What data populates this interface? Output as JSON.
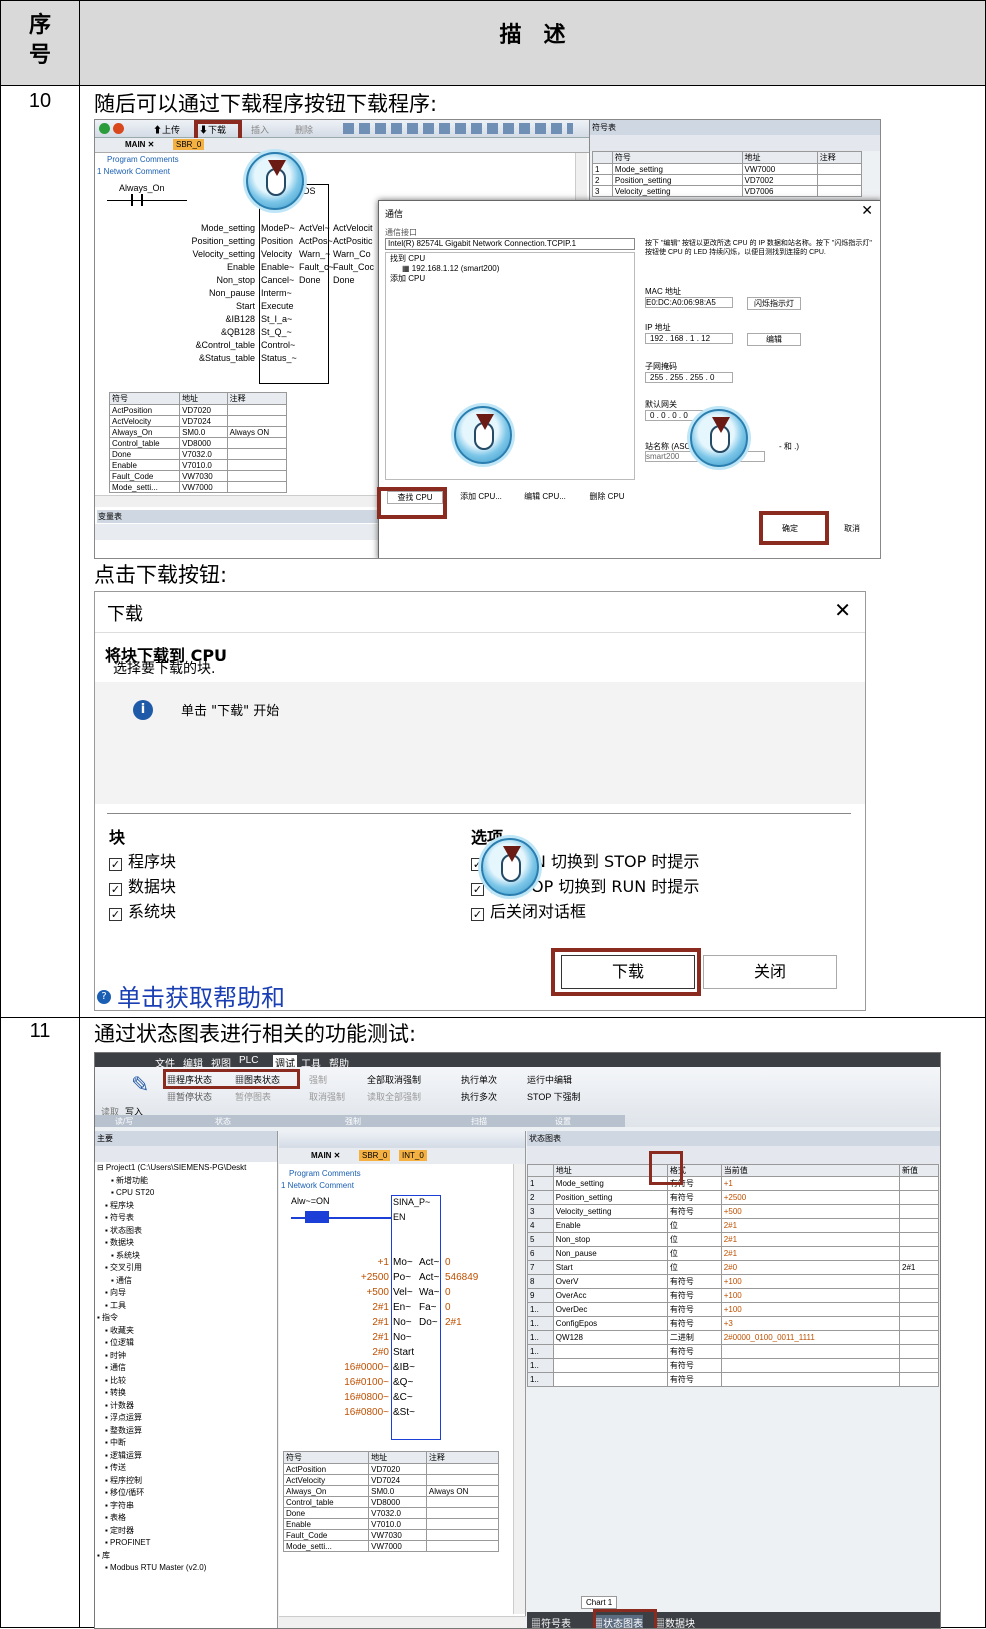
{
  "header": {
    "col1": "序\n号",
    "col2": "描　述"
  },
  "row10": {
    "num": "10",
    "intro": "随后可以通过下载程序按钮下载程序:",
    "toolbar": {
      "upload": "上传",
      "download": "下载",
      "insert": "插入",
      "delete": "删除"
    },
    "tabs": {
      "main": "MAIN",
      "sbr": "SBR_0"
    },
    "program_comments": "Program Comments",
    "network_comment": "Network Comment",
    "always_on": "Always_On",
    "ds": "DS",
    "ladder_left": [
      "Mode_setting",
      "Position_setting",
      "Velocity_setting",
      "Enable",
      "Non_stop",
      "Non_pause",
      "Start",
      "&IB128",
      "&QB128",
      "&Control_table",
      "&Status_table"
    ],
    "ladder_in": [
      "ModeP~",
      "Position",
      "Velocity",
      "Enable~",
      "Cancel~",
      "Interm~",
      "Execute",
      "St_I_a~",
      "St_Q_~",
      "Control~",
      "Status_~"
    ],
    "ladder_out": [
      "ActVel~",
      "ActPos~",
      "Warn_~",
      "Fault_c~",
      "Done"
    ],
    "ladder_right": [
      "ActVelocit",
      "ActPositic",
      "Warn_Co",
      "Fault_Coc",
      "Done"
    ],
    "sym_headers": [
      "符号",
      "地址",
      "注释"
    ],
    "sym_rows": [
      [
        "ActPosition",
        "VD7020",
        ""
      ],
      [
        "ActVelocity",
        "VD7024",
        ""
      ],
      [
        "Always_On",
        "SM0.0",
        "Always ON"
      ],
      [
        "Control_table",
        "VD8000",
        ""
      ],
      [
        "Done",
        "V7032.0",
        ""
      ],
      [
        "Enable",
        "V7010.0",
        ""
      ],
      [
        "Fault_Code",
        "VW7030",
        ""
      ],
      [
        "Mode_setti...",
        "VW7000",
        ""
      ]
    ],
    "var_table": "变量表",
    "symbol_table": {
      "title": "符号表",
      "headers": [
        "符号",
        "地址",
        "注释"
      ],
      "rows": [
        [
          "1",
          "Mode_setting",
          "VW7000"
        ],
        [
          "2",
          "Position_setting",
          "VD7002"
        ],
        [
          "3",
          "Velocity_setting",
          "VD7006"
        ]
      ]
    },
    "comm": {
      "title": "通信",
      "interface_label": "通信接口",
      "interface": "Intel(R) 82574L Gigabit Network Connection.TCPIP.1",
      "found": "找到 CPU",
      "ip_item": "192.168.1.12 (smart200)",
      "add": "添加 CPU",
      "hint": "按下 \"编辑\" 按钮以更改所选 CPU 的 IP 数据和站名称。按下 \"闪烁指示灯\" 按钮使 CPU 的 LED 持续闪烁，以便目测找到连接的 CPU.",
      "mac_label": "MAC 地址",
      "mac": "E0:DC:A0:06:98:A5",
      "blink": "闪烁指示灯",
      "ip_label": "IP 地址",
      "ip": "192 . 168 . 1 . 12",
      "edit": "编辑",
      "mask_label": "子网掩码",
      "mask": "255 . 255 . 255 . 0",
      "gw_label": "默认网关",
      "gw": "0 . 0 . 0 . 0",
      "station_label": "站名称 (ASCII",
      "station_label2": "- 和 .)",
      "station": "smart200",
      "btn_find": "查找 CPU",
      "btn_add": "添加 CPU...",
      "btn_edit": "编辑 CPU...",
      "btn_del": "删除 CPU",
      "ok": "确定",
      "cancel": "取消"
    },
    "click_download": "点击下载按钮:",
    "dl": {
      "title": "下载",
      "heading": "将块下载到 CPU",
      "sub": "选择要下载的块.",
      "info": "单击 \"下载\" 开始",
      "blocks_label": "块",
      "blocks": [
        "程序块",
        "数据块",
        "系统块"
      ],
      "options_label": "选项",
      "options": [
        "从 RUN 切换到 STOP 时提示",
        "从 STOP 切换到 RUN 时提示",
        "后关闭对话框"
      ],
      "help": "单击获取帮助和",
      "btn_download": "下载",
      "btn_close": "关闭"
    }
  },
  "row11": {
    "num": "11",
    "intro": "通过状态图表进行相关的功能测试:",
    "menu": [
      "文件",
      "编辑",
      "视图",
      "PLC",
      "调试",
      "工具",
      "帮助"
    ],
    "ribbon": {
      "read": "读取",
      "write": "写入",
      "prog_status": "程序状态",
      "chart_status": "图表状态",
      "pause_status": "暂停状态",
      "pause_chart": "暂停图表",
      "force": "强制",
      "unforce": "取消强制",
      "unforce_all": "全部取消强制",
      "read_all_forced": "读取全部强制",
      "single": "执行单次",
      "multi": "执行多次",
      "run_edit": "运行中编辑",
      "stop_dl": "STOP 下强制",
      "groups": [
        "读/写",
        "状态",
        "强制",
        "扫描",
        "设置"
      ]
    },
    "tree_title": "主要",
    "tree": [
      "Project1 (C:\\Users\\SIEMENS-PG\\Deskt",
      "新增功能",
      "CPU ST20",
      "程序块",
      "符号表",
      "状态图表",
      "数据块",
      "系统块",
      "交叉引用",
      "通信",
      "向导",
      "工具",
      "指令",
      "收藏夹",
      "位逻辑",
      "时钟",
      "通信",
      "比较",
      "转换",
      "计数器",
      "浮点运算",
      "整数运算",
      "中断",
      "逻辑运算",
      "传送",
      "程序控制",
      "移位/循环",
      "字符串",
      "表格",
      "定时器",
      "PROFINET",
      "库",
      "Modbus RTU Master (v2.0)"
    ],
    "tabs": {
      "main": "MAIN",
      "sbr": "SBR_0",
      "int": "INT_0"
    },
    "program_comments": "Program Comments",
    "network_comment": "Network Comment",
    "alw": "Alw~=ON",
    "sina": "SINA_P~",
    "en": "EN",
    "lad_vals": [
      "+1",
      "+2500",
      "+500",
      "2#1",
      "2#1",
      "2#1",
      "2#0",
      "16#0000~",
      "16#0100~",
      "16#0800~",
      "16#0800~"
    ],
    "lad_in": [
      "Mo~",
      "Po~",
      "Vel~",
      "En~",
      "No~",
      "No~",
      "Start",
      "&IB~",
      "&Q~",
      "&C~",
      "&St~"
    ],
    "lad_out": [
      "Act~",
      "Act~",
      "Wa~",
      "Fa~",
      "Do~"
    ],
    "lad_outv": [
      "0",
      "546849",
      "0",
      "0",
      "2#1"
    ],
    "sym_headers": [
      "符号",
      "地址",
      "注释"
    ],
    "sym_rows": [
      [
        "ActPosition",
        "VD7020",
        ""
      ],
      [
        "ActVelocity",
        "VD7024",
        ""
      ],
      [
        "Always_On",
        "SM0.0",
        "Always ON"
      ],
      [
        "Control_table",
        "VD8000",
        ""
      ],
      [
        "Done",
        "V7032.0",
        ""
      ],
      [
        "Enable",
        "V7010.0",
        ""
      ],
      [
        "Fault_Code",
        "VW7030",
        ""
      ],
      [
        "Mode_setti...",
        "VW7000",
        ""
      ]
    ],
    "status_title": "状态图表",
    "st_headers": [
      "",
      "地址",
      "格式",
      "当前值",
      "新值"
    ],
    "st_rows": [
      [
        "1",
        "Mode_setting",
        "有符号",
        "+1",
        ""
      ],
      [
        "2",
        "Position_setting",
        "有符号",
        "+2500",
        ""
      ],
      [
        "3",
        "Velocity_setting",
        "有符号",
        "+500",
        ""
      ],
      [
        "4",
        "Enable",
        "位",
        "2#1",
        ""
      ],
      [
        "5",
        "Non_stop",
        "位",
        "2#1",
        ""
      ],
      [
        "6",
        "Non_pause",
        "位",
        "2#1",
        ""
      ],
      [
        "7",
        "Start",
        "位",
        "2#0",
        "2#1"
      ],
      [
        "8",
        "OverV",
        "有符号",
        "+100",
        ""
      ],
      [
        "9",
        "OverAcc",
        "有符号",
        "+100",
        ""
      ],
      [
        "1..",
        "OverDec",
        "有符号",
        "+100",
        ""
      ],
      [
        "1..",
        "ConfigEpos",
        "有符号",
        "+3",
        ""
      ],
      [
        "1..",
        "QW128",
        "二进制",
        "2#0000_0100_0011_1111",
        ""
      ],
      [
        "1..",
        "",
        "有符号",
        "",
        ""
      ],
      [
        "1..",
        "",
        "有符号",
        "",
        ""
      ],
      [
        "1..",
        "",
        "有符号",
        "",
        ""
      ]
    ],
    "chart_tab": "Chart 1",
    "bottom_tabs": [
      "符号表",
      "状态图表",
      "数据块"
    ]
  }
}
